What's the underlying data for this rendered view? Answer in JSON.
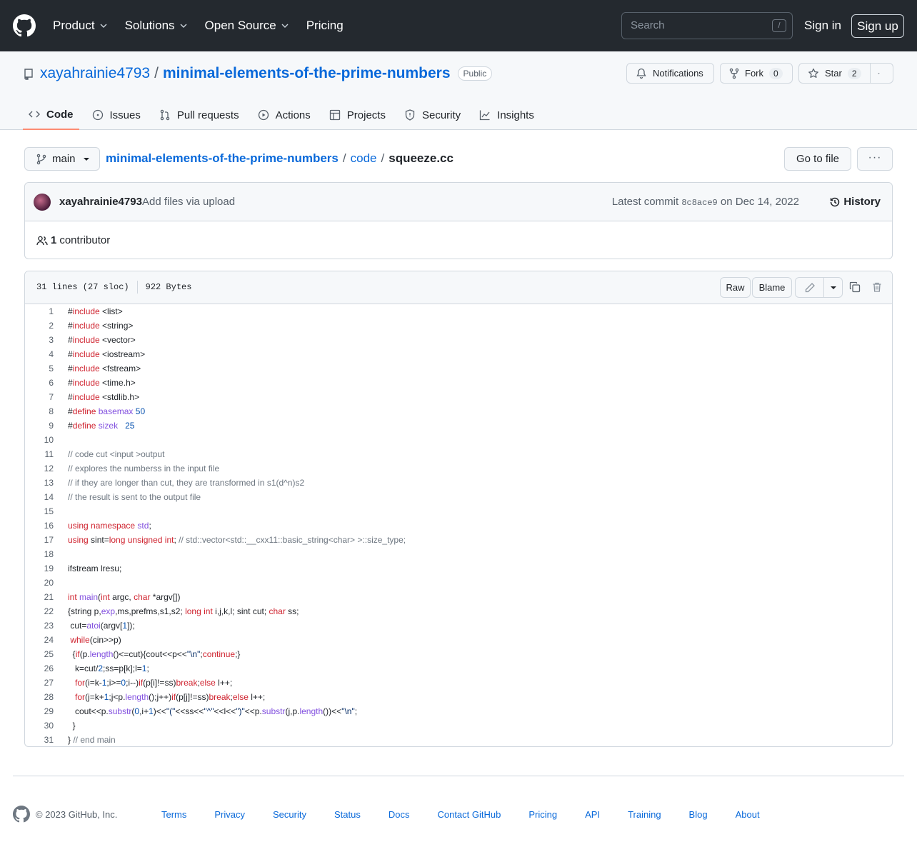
{
  "header": {
    "nav": [
      "Product",
      "Solutions",
      "Open Source",
      "Pricing"
    ],
    "search_placeholder": "Search",
    "search_key": "/",
    "signin": "Sign in",
    "signup": "Sign up"
  },
  "repo": {
    "owner": "xayahrainie4793",
    "separator": "/",
    "name": "minimal-elements-of-the-prime-numbers",
    "visibility": "Public",
    "notifications": "Notifications",
    "fork_label": "Fork",
    "fork_count": "0",
    "star_label": "Star",
    "star_count": "2"
  },
  "tabs": [
    "Code",
    "Issues",
    "Pull requests",
    "Actions",
    "Projects",
    "Security",
    "Insights"
  ],
  "filenav": {
    "branch": "main",
    "crumb_repo": "minimal-elements-of-the-prime-numbers",
    "crumb_dir": "code",
    "crumb_file": "squeeze.cc",
    "slash": "/",
    "go_to_file": "Go to file",
    "more": "···"
  },
  "commit": {
    "author": "xayahrainie4793",
    "message": "Add files via upload",
    "latest_prefix": "Latest commit",
    "sha": "8c8ace9",
    "date": "on Dec 14, 2022",
    "history": "History",
    "contributor_count": "1",
    "contributor_label": "contributor"
  },
  "file": {
    "lines_info": "31 lines (27 sloc)",
    "size": "922 Bytes",
    "raw": "Raw",
    "blame": "Blame"
  },
  "footer": {
    "copyright": "© 2023 GitHub, Inc.",
    "links": [
      "Terms",
      "Privacy",
      "Security",
      "Status",
      "Docs",
      "Contact GitHub",
      "Pricing",
      "API",
      "Training",
      "Blog",
      "About"
    ]
  },
  "code_lines": [
    [
      [
        "p",
        "#"
      ],
      [
        "kw",
        "include"
      ],
      [
        "p",
        " <list>"
      ]
    ],
    [
      [
        "p",
        "#"
      ],
      [
        "kw",
        "include"
      ],
      [
        "p",
        " <string>"
      ]
    ],
    [
      [
        "p",
        "#"
      ],
      [
        "kw",
        "include"
      ],
      [
        "p",
        " <vector>"
      ]
    ],
    [
      [
        "p",
        "#"
      ],
      [
        "kw",
        "include"
      ],
      [
        "p",
        " <iostream>"
      ]
    ],
    [
      [
        "p",
        "#"
      ],
      [
        "kw",
        "include"
      ],
      [
        "p",
        " <fstream>"
      ]
    ],
    [
      [
        "p",
        "#"
      ],
      [
        "kw",
        "include"
      ],
      [
        "p",
        " <time.h>"
      ]
    ],
    [
      [
        "p",
        "#"
      ],
      [
        "kw",
        "include"
      ],
      [
        "p",
        " <stdlib.h>"
      ]
    ],
    [
      [
        "p",
        "#"
      ],
      [
        "kw",
        "define"
      ],
      [
        "p",
        " "
      ],
      [
        "fn",
        "basemax"
      ],
      [
        "p",
        " "
      ],
      [
        "num",
        "50"
      ]
    ],
    [
      [
        "p",
        "#"
      ],
      [
        "kw",
        "define"
      ],
      [
        "p",
        " "
      ],
      [
        "fn",
        "sizek"
      ],
      [
        "p",
        "   "
      ],
      [
        "num",
        "25"
      ]
    ],
    [],
    [
      [
        "cm",
        "// code cut <input >output"
      ]
    ],
    [
      [
        "cm",
        "// explores the numberss in the input file"
      ]
    ],
    [
      [
        "cm",
        "// if they are longer than cut, they are transformed in s1(d^n)s2"
      ]
    ],
    [
      [
        "cm",
        "// the result is sent to the output file"
      ]
    ],
    [],
    [
      [
        "kw",
        "using"
      ],
      [
        "p",
        " "
      ],
      [
        "kw",
        "namespace"
      ],
      [
        "p",
        " "
      ],
      [
        "fn",
        "std"
      ],
      [
        "p",
        ";"
      ]
    ],
    [
      [
        "kw",
        "using"
      ],
      [
        "p",
        " sint="
      ],
      [
        "kw",
        "long"
      ],
      [
        "p",
        " "
      ],
      [
        "kw",
        "unsigned"
      ],
      [
        "p",
        " "
      ],
      [
        "kw",
        "int"
      ],
      [
        "p",
        "; "
      ],
      [
        "cm",
        "// std::vector<std::__cxx11::basic_string<char> >::size_type;"
      ]
    ],
    [],
    [
      [
        "p",
        "ifstream lresu;"
      ]
    ],
    [],
    [
      [
        "kw",
        "int"
      ],
      [
        "p",
        " "
      ],
      [
        "fn",
        "main"
      ],
      [
        "p",
        "("
      ],
      [
        "kw",
        "int"
      ],
      [
        "p",
        " argc, "
      ],
      [
        "kw",
        "char"
      ],
      [
        "p",
        " *argv[])"
      ]
    ],
    [
      [
        "p",
        "{string p,"
      ],
      [
        "fn",
        "exp"
      ],
      [
        "p",
        ",ms,prefms,s1,s2; "
      ],
      [
        "kw",
        "long"
      ],
      [
        "p",
        " "
      ],
      [
        "kw",
        "int"
      ],
      [
        "p",
        " i,j,k,l; sint cut; "
      ],
      [
        "kw",
        "char"
      ],
      [
        "p",
        " ss;"
      ]
    ],
    [
      [
        "p",
        " cut="
      ],
      [
        "fn",
        "atoi"
      ],
      [
        "p",
        "(argv["
      ],
      [
        "num",
        "1"
      ],
      [
        "p",
        "]);"
      ]
    ],
    [
      [
        "p",
        " "
      ],
      [
        "kw",
        "while"
      ],
      [
        "p",
        "(cin>>p)"
      ]
    ],
    [
      [
        "p",
        "  {"
      ],
      [
        "kw",
        "if"
      ],
      [
        "p",
        "(p."
      ],
      [
        "fn",
        "length"
      ],
      [
        "p",
        "()<=cut){cout<<p<<"
      ],
      [
        "str",
        "\"\\n\""
      ],
      [
        "p",
        ";"
      ],
      [
        "kw",
        "continue"
      ],
      [
        "p",
        ";}"
      ]
    ],
    [
      [
        "p",
        "   k=cut/"
      ],
      [
        "num",
        "2"
      ],
      [
        "p",
        ";ss=p[k];l="
      ],
      [
        "num",
        "1"
      ],
      [
        "p",
        ";"
      ]
    ],
    [
      [
        "p",
        "   "
      ],
      [
        "kw",
        "for"
      ],
      [
        "p",
        "(i=k-"
      ],
      [
        "num",
        "1"
      ],
      [
        "p",
        ";i>="
      ],
      [
        "num",
        "0"
      ],
      [
        "p",
        ";i--)"
      ],
      [
        "kw",
        "if"
      ],
      [
        "p",
        "(p[i]!=ss)"
      ],
      [
        "kw",
        "break"
      ],
      [
        "p",
        ";"
      ],
      [
        "kw",
        "else"
      ],
      [
        "p",
        " l++;"
      ]
    ],
    [
      [
        "p",
        "   "
      ],
      [
        "kw",
        "for"
      ],
      [
        "p",
        "(j=k+"
      ],
      [
        "num",
        "1"
      ],
      [
        "p",
        ";j<p."
      ],
      [
        "fn",
        "length"
      ],
      [
        "p",
        "();j++)"
      ],
      [
        "kw",
        "if"
      ],
      [
        "p",
        "(p[j]!=ss)"
      ],
      [
        "kw",
        "break"
      ],
      [
        "p",
        ";"
      ],
      [
        "kw",
        "else"
      ],
      [
        "p",
        " l++;"
      ]
    ],
    [
      [
        "p",
        "   cout<<p."
      ],
      [
        "fn",
        "substr"
      ],
      [
        "p",
        "("
      ],
      [
        "num",
        "0"
      ],
      [
        "p",
        ",i+"
      ],
      [
        "num",
        "1"
      ],
      [
        "p",
        ")<<"
      ],
      [
        "str",
        "\"(\""
      ],
      [
        "p",
        "<<ss<<"
      ],
      [
        "str",
        "\"^\""
      ],
      [
        "p",
        "<<l<<"
      ],
      [
        "str",
        "\")\""
      ],
      [
        "p",
        "<<p."
      ],
      [
        "fn",
        "substr"
      ],
      [
        "p",
        "(j,p."
      ],
      [
        "fn",
        "length"
      ],
      [
        "p",
        "())<<"
      ],
      [
        "str",
        "\"\\n\""
      ],
      [
        "p",
        ";"
      ]
    ],
    [
      [
        "p",
        "  }"
      ]
    ],
    [
      [
        "p",
        "} "
      ],
      [
        "cm",
        "// end main"
      ]
    ]
  ]
}
